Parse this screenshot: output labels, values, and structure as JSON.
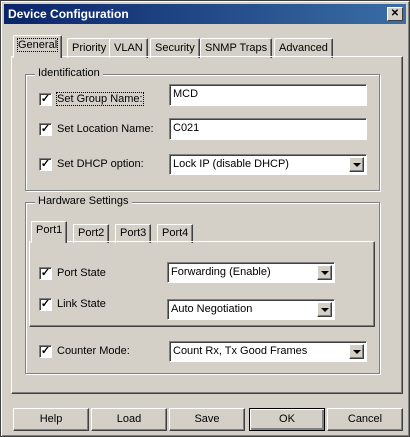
{
  "window": {
    "title": "Device Configuration",
    "close_glyph": "✕"
  },
  "tabs": [
    "General",
    "Priority",
    "VLAN",
    "Security",
    "SNMP Traps",
    "Advanced"
  ],
  "identification": {
    "title": "Identification",
    "group_name": {
      "label": "Set Group Name:",
      "checked": true,
      "value": "MCD"
    },
    "location_name": {
      "label": "Set Location Name:",
      "checked": true,
      "value": "C021"
    },
    "dhcp_option": {
      "label": "Set DHCP option:",
      "checked": true,
      "value": "Lock IP (disable DHCP)"
    }
  },
  "hardware": {
    "title": "Hardware Settings",
    "port_tabs": [
      "Port1",
      "Port2",
      "Port3",
      "Port4"
    ],
    "port_state": {
      "label": "Port State",
      "checked": true,
      "value": "Forwarding (Enable)"
    },
    "link_state": {
      "label": "Link State",
      "checked": true,
      "value": "Auto Negotiation"
    },
    "counter_mode": {
      "label": "Counter Mode:",
      "checked": true,
      "value": "Count Rx, Tx Good Frames"
    }
  },
  "buttons": {
    "help": "Help",
    "load": "Load",
    "save": "Save",
    "ok": "OK",
    "cancel": "Cancel"
  },
  "check_glyph": "✓"
}
